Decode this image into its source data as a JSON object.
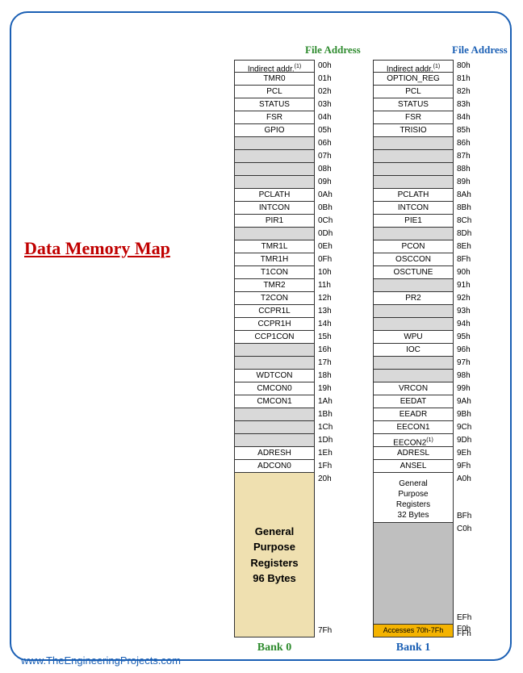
{
  "title": "Data Memory Map",
  "footer": "www.TheEngineeringProjects.com",
  "headers": {
    "left": "File Address",
    "right": "File Address"
  },
  "banks": {
    "left": "Bank 0",
    "right": "Bank 1"
  },
  "bank0_regs": [
    {
      "name": "Indirect addr.",
      "addr": "00h",
      "sup": "(1)"
    },
    {
      "name": "TMR0",
      "addr": "01h"
    },
    {
      "name": "PCL",
      "addr": "02h"
    },
    {
      "name": "STATUS",
      "addr": "03h"
    },
    {
      "name": "FSR",
      "addr": "04h"
    },
    {
      "name": "GPIO",
      "addr": "05h"
    },
    {
      "name": "",
      "addr": "06h",
      "empty": true
    },
    {
      "name": "",
      "addr": "07h",
      "empty": true
    },
    {
      "name": "",
      "addr": "08h",
      "empty": true
    },
    {
      "name": "",
      "addr": "09h",
      "empty": true
    },
    {
      "name": "PCLATH",
      "addr": "0Ah"
    },
    {
      "name": "INTCON",
      "addr": "0Bh"
    },
    {
      "name": "PIR1",
      "addr": "0Ch"
    },
    {
      "name": "",
      "addr": "0Dh",
      "empty": true
    },
    {
      "name": "TMR1L",
      "addr": "0Eh"
    },
    {
      "name": "TMR1H",
      "addr": "0Fh"
    },
    {
      "name": "T1CON",
      "addr": "10h"
    },
    {
      "name": "TMR2",
      "addr": "11h"
    },
    {
      "name": "T2CON",
      "addr": "12h"
    },
    {
      "name": "CCPR1L",
      "addr": "13h"
    },
    {
      "name": "CCPR1H",
      "addr": "14h"
    },
    {
      "name": "CCP1CON",
      "addr": "15h"
    },
    {
      "name": "",
      "addr": "16h",
      "empty": true
    },
    {
      "name": "",
      "addr": "17h",
      "empty": true
    },
    {
      "name": "WDTCON",
      "addr": "18h"
    },
    {
      "name": "CMCON0",
      "addr": "19h"
    },
    {
      "name": "CMCON1",
      "addr": "1Ah"
    },
    {
      "name": "",
      "addr": "1Bh",
      "empty": true
    },
    {
      "name": "",
      "addr": "1Ch",
      "empty": true
    },
    {
      "name": "",
      "addr": "1Dh",
      "empty": true
    },
    {
      "name": "ADRESH",
      "addr": "1Eh"
    },
    {
      "name": "ADCON0",
      "addr": "1Fh"
    }
  ],
  "bank0_gpr": {
    "lines": [
      "General",
      "Purpose",
      "Registers",
      "96 Bytes"
    ],
    "start": "20h",
    "end": "7Fh"
  },
  "bank1_regs": [
    {
      "name": "Indirect addr.",
      "addr": "80h",
      "sup": "(1)"
    },
    {
      "name": "OPTION_REG",
      "addr": "81h"
    },
    {
      "name": "PCL",
      "addr": "82h"
    },
    {
      "name": "STATUS",
      "addr": "83h"
    },
    {
      "name": "FSR",
      "addr": "84h"
    },
    {
      "name": "TRISIO",
      "addr": "85h"
    },
    {
      "name": "",
      "addr": "86h",
      "empty": true
    },
    {
      "name": "",
      "addr": "87h",
      "empty": true
    },
    {
      "name": "",
      "addr": "88h",
      "empty": true
    },
    {
      "name": "",
      "addr": "89h",
      "empty": true
    },
    {
      "name": "PCLATH",
      "addr": "8Ah"
    },
    {
      "name": "INTCON",
      "addr": "8Bh"
    },
    {
      "name": "PIE1",
      "addr": "8Ch"
    },
    {
      "name": "",
      "addr": "8Dh",
      "empty": true
    },
    {
      "name": "PCON",
      "addr": "8Eh"
    },
    {
      "name": "OSCCON",
      "addr": "8Fh"
    },
    {
      "name": "OSCTUNE",
      "addr": "90h"
    },
    {
      "name": "",
      "addr": "91h",
      "empty": true
    },
    {
      "name": "PR2",
      "addr": "92h"
    },
    {
      "name": "",
      "addr": "93h",
      "empty": true
    },
    {
      "name": "",
      "addr": "94h",
      "empty": true
    },
    {
      "name": "WPU",
      "addr": "95h"
    },
    {
      "name": "IOC",
      "addr": "96h"
    },
    {
      "name": "",
      "addr": "97h",
      "empty": true
    },
    {
      "name": "",
      "addr": "98h",
      "empty": true
    },
    {
      "name": "VRCON",
      "addr": "99h"
    },
    {
      "name": "EEDAT",
      "addr": "9Ah"
    },
    {
      "name": "EEADR",
      "addr": "9Bh"
    },
    {
      "name": "EECON1",
      "addr": "9Ch"
    },
    {
      "name": "EECON2",
      "addr": "9Dh",
      "sup": "(1)"
    },
    {
      "name": "ADRESL",
      "addr": "9Eh"
    },
    {
      "name": "ANSEL",
      "addr": "9Fh"
    }
  ],
  "bank1_gpr": {
    "lines": [
      "General",
      "Purpose",
      "Registers",
      "32 Bytes"
    ],
    "start": "A0h",
    "end": "BFh"
  },
  "bank1_gray": {
    "start": "C0h",
    "end": "EFh"
  },
  "bank1_access": {
    "label": "Accesses 70h-7Fh",
    "start": "F0h",
    "end": "FFh"
  }
}
